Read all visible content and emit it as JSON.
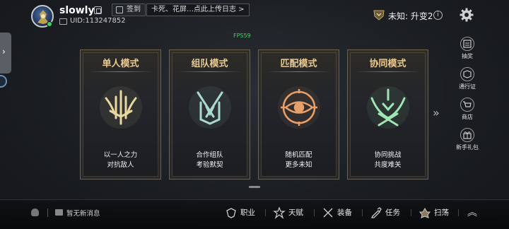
{
  "header": {
    "username": "slowly",
    "checkin_label": "签到",
    "uid": "UID:113247852",
    "log_button": "卡死、花屏…点此上传日志 >",
    "rank_text": "未知: 升变2",
    "info_glyph": "i",
    "fps": "FPS59"
  },
  "modes": [
    {
      "title": "单人模式",
      "desc1": "以一人之力",
      "desc2": "对抗敌人",
      "color": "#e8d9a0"
    },
    {
      "title": "组队模式",
      "desc1": "合作组队",
      "desc2": "考验默契",
      "color": "#a9d9cf"
    },
    {
      "title": "匹配模式",
      "desc1": "随机匹配",
      "desc2": "更多未知",
      "color": "#e8a06a"
    },
    {
      "title": "协同模式",
      "desc1": "协同挑战",
      "desc2": "共度难关",
      "color": "#9fe6b4"
    }
  ],
  "side_tab_glyph": "›",
  "more_glyph": "»",
  "rail": [
    {
      "label": "抽奖",
      "icon": "lottery-icon"
    },
    {
      "label": "通行证",
      "icon": "pass-icon"
    },
    {
      "label": "商店",
      "icon": "cart-icon"
    },
    {
      "label": "新手礼包",
      "icon": "gift-icon"
    }
  ],
  "bottom": {
    "message": "暂无新消息",
    "nav": [
      {
        "label": "职业",
        "icon": "class-icon"
      },
      {
        "label": "天赋",
        "icon": "talent-icon"
      },
      {
        "label": "装备",
        "icon": "equipment-icon"
      },
      {
        "label": "任务",
        "icon": "task-icon"
      },
      {
        "label": "扫荡",
        "icon": "sweep-icon"
      }
    ],
    "up_glyph": "︽"
  }
}
